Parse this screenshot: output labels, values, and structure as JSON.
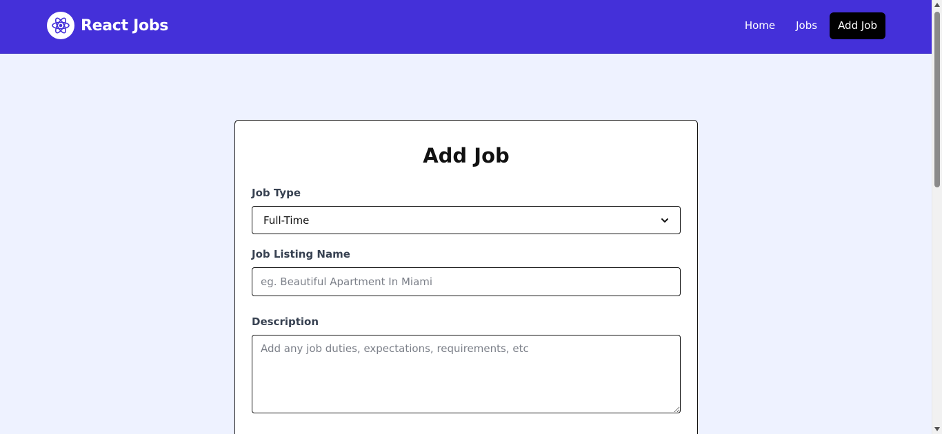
{
  "navbar": {
    "brand": "React Jobs",
    "logo_icon": "react-atom-icon",
    "background": "#4430d9",
    "links": [
      {
        "label": "Home",
        "active": false
      },
      {
        "label": "Jobs",
        "active": false
      },
      {
        "label": "Add Job",
        "active": true
      }
    ]
  },
  "form": {
    "title": "Add Job",
    "job_type": {
      "label": "Job Type",
      "selected": "Full-Time",
      "icon": "chevron-down-icon"
    },
    "listing_name": {
      "label": "Job Listing Name",
      "value": "",
      "placeholder": "eg. Beautiful Apartment In Miami"
    },
    "description": {
      "label": "Description",
      "value": "",
      "placeholder": "Add any job duties, expectations, requirements, etc"
    }
  }
}
